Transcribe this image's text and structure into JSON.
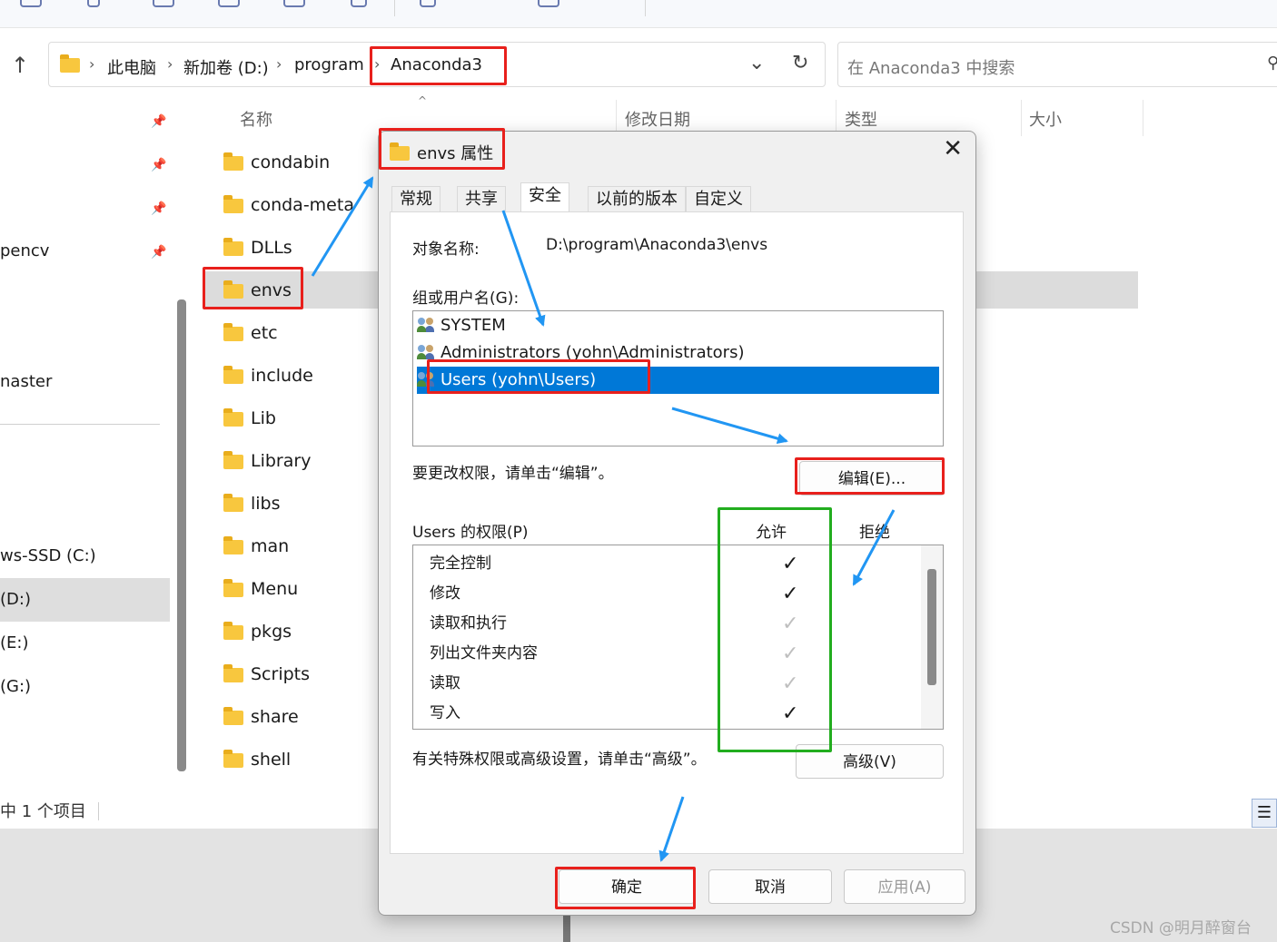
{
  "explorer": {
    "address": {
      "crumbs": [
        "此电脑",
        "新加卷 (D:)",
        "program",
        "Anaconda3"
      ]
    },
    "search_placeholder": "在 Anaconda3 中搜索",
    "columns": {
      "name": "名称",
      "modified": "修改日期",
      "type": "类型",
      "size": "大小"
    },
    "nav_pane": {
      "items": [
        "pencv",
        "naster",
        "ws-SSD (C:)",
        "(D:)",
        "(E:)",
        "(G:)"
      ]
    },
    "files": [
      "condabin",
      "conda-meta",
      "DLLs",
      "envs",
      "etc",
      "include",
      "Lib",
      "Library",
      "libs",
      "man",
      "Menu",
      "pkgs",
      "Scripts",
      "share",
      "shell"
    ],
    "selected_file": "envs",
    "status": "中 1 个项目"
  },
  "dialog": {
    "title": "envs 属性",
    "tabs": [
      "常规",
      "共享",
      "安全",
      "以前的版本",
      "自定义"
    ],
    "active_tab": "安全",
    "object_label": "对象名称:",
    "object_value": "D:\\program\\Anaconda3\\envs",
    "group_label": "组或用户名(G):",
    "users": [
      "SYSTEM",
      "Administrators (yohn\\Administrators)",
      "Users (yohn\\Users)"
    ],
    "selected_user": "Users (yohn\\Users)",
    "edit_hint": "要更改权限，请单击“编辑”。",
    "edit_button": "编辑(E)...",
    "perm_label": "Users 的权限(P)",
    "allow_header": "允许",
    "deny_header": "拒绝",
    "permissions": [
      {
        "name": "完全控制",
        "allow": "explicit"
      },
      {
        "name": "修改",
        "allow": "explicit"
      },
      {
        "name": "读取和执行",
        "allow": "inherited"
      },
      {
        "name": "列出文件夹内容",
        "allow": "inherited"
      },
      {
        "name": "读取",
        "allow": "inherited"
      },
      {
        "name": "写入",
        "allow": "explicit"
      }
    ],
    "advanced_hint": "有关特殊权限或高级设置，请单击“高级”。",
    "advanced_button": "高级(V)",
    "ok_button": "确定",
    "cancel_button": "取消",
    "apply_button": "应用(A)",
    "close_icon": "close-icon"
  },
  "colors": {
    "annotation_red": "#e8201c",
    "annotation_green": "#22ad1f",
    "annotation_arrow": "#2196f3",
    "selection_blue": "#0078d7"
  },
  "watermark": "CSDN @明月醉窗台"
}
